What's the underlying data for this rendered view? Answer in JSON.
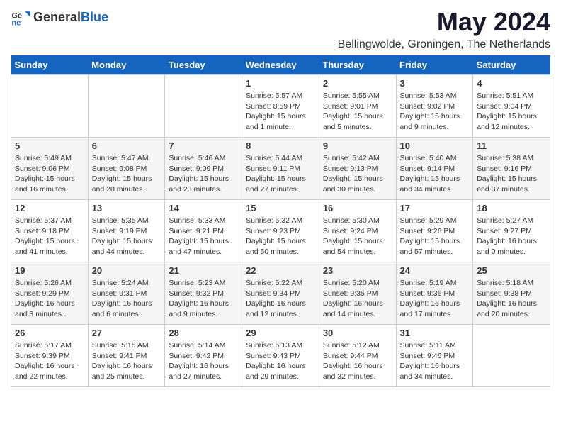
{
  "logo": {
    "general": "General",
    "blue": "Blue"
  },
  "title": "May 2024",
  "location": "Bellingwolde, Groningen, The Netherlands",
  "days_of_week": [
    "Sunday",
    "Monday",
    "Tuesday",
    "Wednesday",
    "Thursday",
    "Friday",
    "Saturday"
  ],
  "weeks": [
    [
      {
        "day": "",
        "info": ""
      },
      {
        "day": "",
        "info": ""
      },
      {
        "day": "",
        "info": ""
      },
      {
        "day": "1",
        "info": "Sunrise: 5:57 AM\nSunset: 8:59 PM\nDaylight: 15 hours\nand 1 minute."
      },
      {
        "day": "2",
        "info": "Sunrise: 5:55 AM\nSunset: 9:01 PM\nDaylight: 15 hours\nand 5 minutes."
      },
      {
        "day": "3",
        "info": "Sunrise: 5:53 AM\nSunset: 9:02 PM\nDaylight: 15 hours\nand 9 minutes."
      },
      {
        "day": "4",
        "info": "Sunrise: 5:51 AM\nSunset: 9:04 PM\nDaylight: 15 hours\nand 12 minutes."
      }
    ],
    [
      {
        "day": "5",
        "info": "Sunrise: 5:49 AM\nSunset: 9:06 PM\nDaylight: 15 hours\nand 16 minutes."
      },
      {
        "day": "6",
        "info": "Sunrise: 5:47 AM\nSunset: 9:08 PM\nDaylight: 15 hours\nand 20 minutes."
      },
      {
        "day": "7",
        "info": "Sunrise: 5:46 AM\nSunset: 9:09 PM\nDaylight: 15 hours\nand 23 minutes."
      },
      {
        "day": "8",
        "info": "Sunrise: 5:44 AM\nSunset: 9:11 PM\nDaylight: 15 hours\nand 27 minutes."
      },
      {
        "day": "9",
        "info": "Sunrise: 5:42 AM\nSunset: 9:13 PM\nDaylight: 15 hours\nand 30 minutes."
      },
      {
        "day": "10",
        "info": "Sunrise: 5:40 AM\nSunset: 9:14 PM\nDaylight: 15 hours\nand 34 minutes."
      },
      {
        "day": "11",
        "info": "Sunrise: 5:38 AM\nSunset: 9:16 PM\nDaylight: 15 hours\nand 37 minutes."
      }
    ],
    [
      {
        "day": "12",
        "info": "Sunrise: 5:37 AM\nSunset: 9:18 PM\nDaylight: 15 hours\nand 41 minutes."
      },
      {
        "day": "13",
        "info": "Sunrise: 5:35 AM\nSunset: 9:19 PM\nDaylight: 15 hours\nand 44 minutes."
      },
      {
        "day": "14",
        "info": "Sunrise: 5:33 AM\nSunset: 9:21 PM\nDaylight: 15 hours\nand 47 minutes."
      },
      {
        "day": "15",
        "info": "Sunrise: 5:32 AM\nSunset: 9:23 PM\nDaylight: 15 hours\nand 50 minutes."
      },
      {
        "day": "16",
        "info": "Sunrise: 5:30 AM\nSunset: 9:24 PM\nDaylight: 15 hours\nand 54 minutes."
      },
      {
        "day": "17",
        "info": "Sunrise: 5:29 AM\nSunset: 9:26 PM\nDaylight: 15 hours\nand 57 minutes."
      },
      {
        "day": "18",
        "info": "Sunrise: 5:27 AM\nSunset: 9:27 PM\nDaylight: 16 hours\nand 0 minutes."
      }
    ],
    [
      {
        "day": "19",
        "info": "Sunrise: 5:26 AM\nSunset: 9:29 PM\nDaylight: 16 hours\nand 3 minutes."
      },
      {
        "day": "20",
        "info": "Sunrise: 5:24 AM\nSunset: 9:31 PM\nDaylight: 16 hours\nand 6 minutes."
      },
      {
        "day": "21",
        "info": "Sunrise: 5:23 AM\nSunset: 9:32 PM\nDaylight: 16 hours\nand 9 minutes."
      },
      {
        "day": "22",
        "info": "Sunrise: 5:22 AM\nSunset: 9:34 PM\nDaylight: 16 hours\nand 12 minutes."
      },
      {
        "day": "23",
        "info": "Sunrise: 5:20 AM\nSunset: 9:35 PM\nDaylight: 16 hours\nand 14 minutes."
      },
      {
        "day": "24",
        "info": "Sunrise: 5:19 AM\nSunset: 9:36 PM\nDaylight: 16 hours\nand 17 minutes."
      },
      {
        "day": "25",
        "info": "Sunrise: 5:18 AM\nSunset: 9:38 PM\nDaylight: 16 hours\nand 20 minutes."
      }
    ],
    [
      {
        "day": "26",
        "info": "Sunrise: 5:17 AM\nSunset: 9:39 PM\nDaylight: 16 hours\nand 22 minutes."
      },
      {
        "day": "27",
        "info": "Sunrise: 5:15 AM\nSunset: 9:41 PM\nDaylight: 16 hours\nand 25 minutes."
      },
      {
        "day": "28",
        "info": "Sunrise: 5:14 AM\nSunset: 9:42 PM\nDaylight: 16 hours\nand 27 minutes."
      },
      {
        "day": "29",
        "info": "Sunrise: 5:13 AM\nSunset: 9:43 PM\nDaylight: 16 hours\nand 29 minutes."
      },
      {
        "day": "30",
        "info": "Sunrise: 5:12 AM\nSunset: 9:44 PM\nDaylight: 16 hours\nand 32 minutes."
      },
      {
        "day": "31",
        "info": "Sunrise: 5:11 AM\nSunset: 9:46 PM\nDaylight: 16 hours\nand 34 minutes."
      },
      {
        "day": "",
        "info": ""
      }
    ]
  ]
}
